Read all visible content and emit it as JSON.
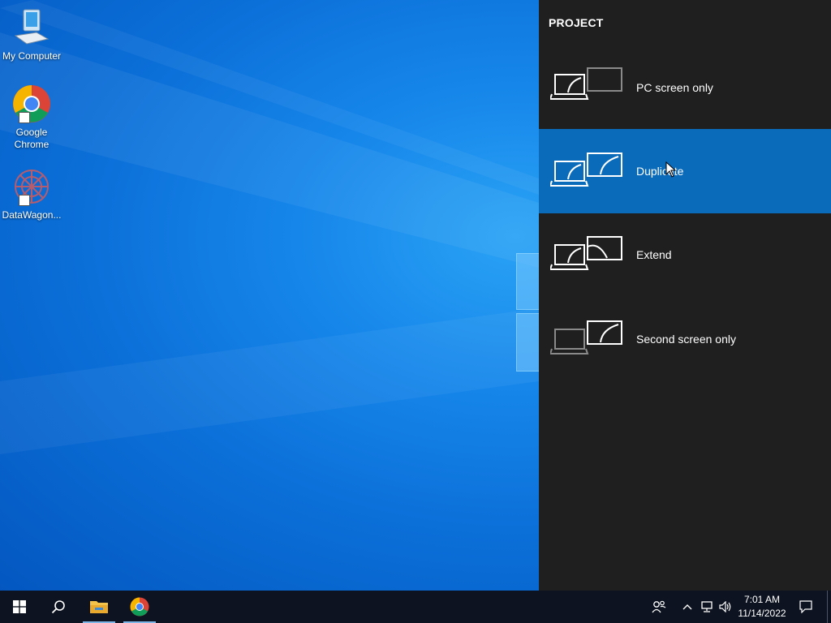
{
  "desktop": {
    "icons": [
      {
        "label": "My Computer",
        "icon": "computer-icon"
      },
      {
        "label": "Google Chrome",
        "icon": "chrome-icon"
      },
      {
        "label": "DataWagon...",
        "icon": "datawagon-icon"
      }
    ]
  },
  "project": {
    "title": "PROJECT",
    "options": [
      {
        "label": "PC screen only",
        "selected": false
      },
      {
        "label": "Duplicate",
        "selected": true
      },
      {
        "label": "Extend",
        "selected": false
      },
      {
        "label": "Second screen only",
        "selected": false
      }
    ]
  },
  "taskbar": {
    "time": "7:01 AM",
    "date": "11/14/2022",
    "pinned": [
      "file-explorer-icon",
      "chrome-icon"
    ],
    "tray_icons": [
      "people-icon",
      "chevron-up-icon",
      "network-icon",
      "volume-icon",
      "notification-icon"
    ]
  },
  "colors": {
    "accent": "#0b6bbb",
    "panel_bg": "#1f1f1f",
    "taskbar_bg": "#0d1320"
  }
}
